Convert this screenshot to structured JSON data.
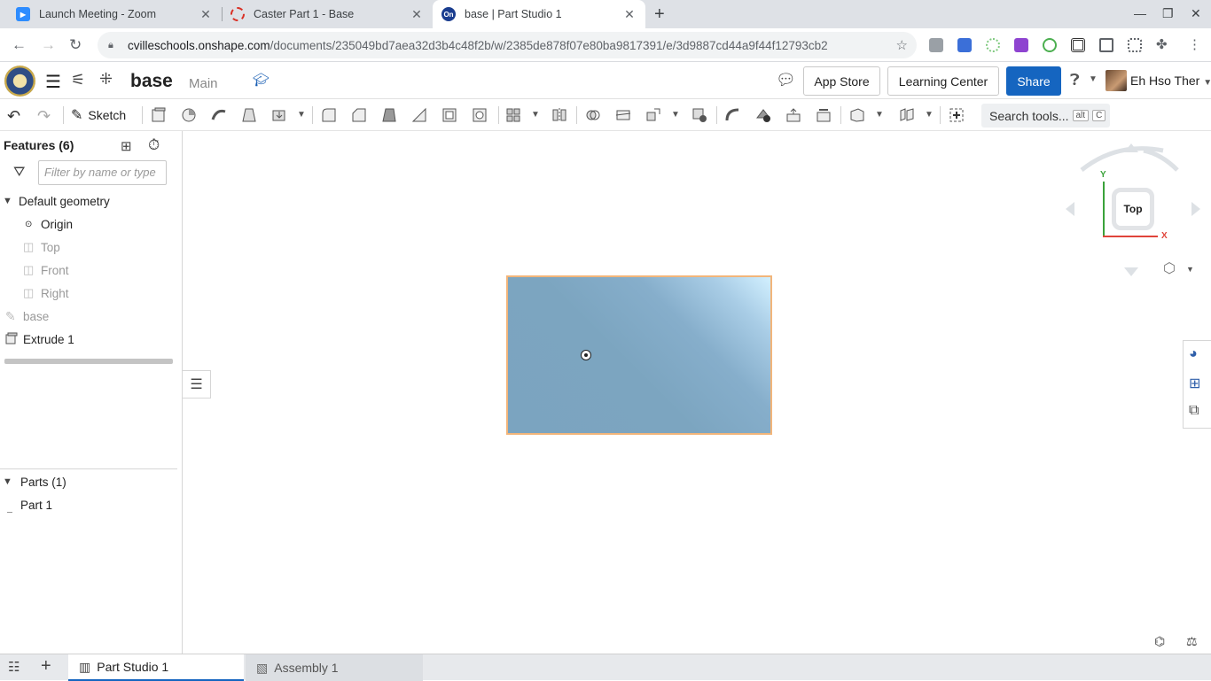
{
  "browser": {
    "tabs": [
      {
        "title": "Launch Meeting - Zoom",
        "favicon": "zoom-icon",
        "color": "#2d8cff"
      },
      {
        "title": "Caster Part 1 - Base",
        "favicon": "onshape-ring-icon",
        "color": "#d93025"
      },
      {
        "title": "base | Part Studio 1",
        "favicon": "onshape-icon",
        "color": "#1a3d8f",
        "active": true
      }
    ],
    "url_host": "cvilleschools.onshape.com",
    "url_path": "/documents/235049bd7aea32d3b4c48f2b/w/2385de878f07e80ba9817391/e/3d9887cd44a9f44f12793cb2"
  },
  "header": {
    "doc_name": "base",
    "branch": "Main",
    "app_store": "App Store",
    "learning_center": "Learning Center",
    "share": "Share",
    "user_name": "Eh Hso Ther"
  },
  "toolbar": {
    "sketch": "Sketch",
    "search_tools": "Search tools...",
    "shortcut_keys": [
      "alt",
      "C"
    ]
  },
  "features": {
    "title": "Features (6)",
    "filter_placeholder": "Filter by name or type",
    "default_geometry": "Default geometry",
    "items": [
      {
        "label": "Origin"
      },
      {
        "label": "Top"
      },
      {
        "label": "Front"
      },
      {
        "label": "Right"
      },
      {
        "label": "base"
      },
      {
        "label": "Extrude 1"
      }
    ]
  },
  "parts": {
    "title": "Parts (1)",
    "items": [
      "Part 1"
    ]
  },
  "viewcube": {
    "face": "Top",
    "axis_x": "X",
    "axis_y": "Y"
  },
  "bottom_tabs": [
    {
      "label": "Part Studio 1",
      "active": true
    },
    {
      "label": "Assembly 1",
      "active": false
    }
  ],
  "colors": {
    "accent": "#1565c0",
    "part_fill": "#7ba4c0",
    "part_edge": "#f2b57a"
  }
}
